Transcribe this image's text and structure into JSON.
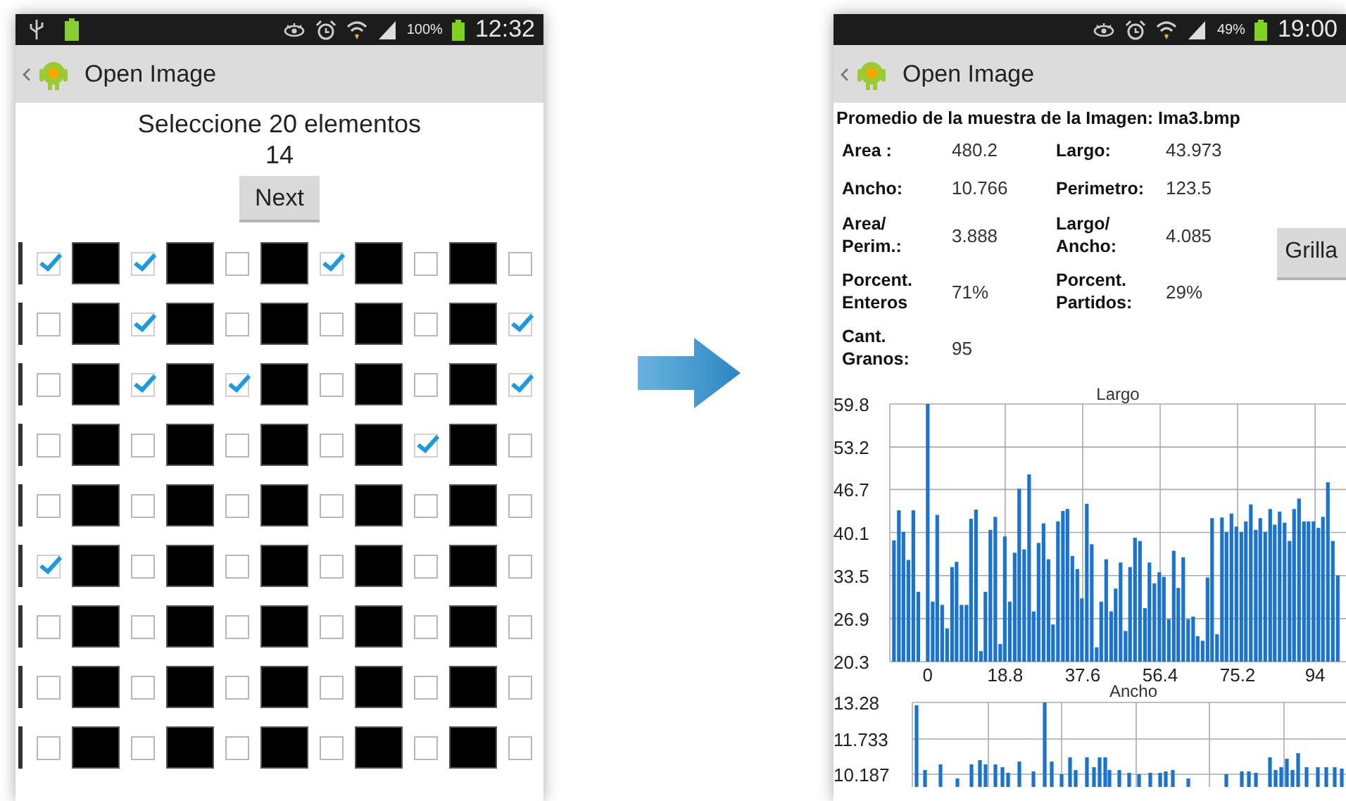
{
  "left_phone": {
    "status_bar": {
      "battery": "100%",
      "time": "12:32"
    },
    "action_bar": {
      "title": "Open Image"
    },
    "prompt": "Seleccione 20 elementos",
    "count": "14",
    "next_button": "Next",
    "grid": {
      "rows": [
        {
          "checks": [
            true,
            true,
            false,
            true,
            false,
            false
          ]
        },
        {
          "checks": [
            false,
            true,
            false,
            false,
            false,
            true
          ]
        },
        {
          "checks": [
            false,
            true,
            true,
            false,
            false,
            true
          ]
        },
        {
          "checks": [
            false,
            false,
            false,
            false,
            true,
            false
          ]
        },
        {
          "checks": [
            false,
            false,
            false,
            false,
            false,
            false
          ]
        },
        {
          "checks": [
            true,
            false,
            false,
            false,
            false,
            false
          ]
        },
        {
          "checks": [
            false,
            false,
            false,
            false,
            false,
            false
          ]
        },
        {
          "checks": [
            false,
            false,
            false,
            false,
            false,
            false
          ]
        },
        {
          "checks": [
            false,
            false,
            false,
            false,
            false,
            false
          ]
        }
      ]
    }
  },
  "right_phone": {
    "status_bar": {
      "battery": "49%",
      "time": "19:00"
    },
    "action_bar": {
      "title": "Open Image"
    },
    "heading": "Promedio de la muestra de la Imagen: Ima3.bmp",
    "stats": [
      [
        {
          "label": "Area :",
          "value": "480.2"
        },
        {
          "label": "Largo:",
          "value": "43.973"
        }
      ],
      [
        {
          "label": "Ancho:",
          "value": "10.766"
        },
        {
          "label": "Perimetro:",
          "value": "123.5"
        }
      ],
      [
        {
          "label": "Area/\nPerim.:",
          "value": "3.888"
        },
        {
          "label": "Largo/\nAncho:",
          "value": "4.085"
        }
      ],
      [
        {
          "label": "Porcent.\nEnteros",
          "value": "71%"
        },
        {
          "label": "Porcent.\nPartidos:",
          "value": "29%"
        }
      ],
      [
        {
          "label": "Cant.\nGranos:",
          "value": "95"
        }
      ]
    ],
    "grilla_button": "Grilla",
    "largo_chart": {
      "chart_data": {
        "type": "bar",
        "title": "Largo",
        "x": [
          -8.2,
          -7.0,
          -5.9,
          -4.7,
          -3.5,
          -2.3,
          0,
          1.2,
          2.3,
          3.5,
          4.7,
          5.9,
          7.0,
          8.2,
          9.4,
          10.5,
          11.7,
          12.9,
          14.0,
          15.2,
          16.4,
          17.6,
          18.7,
          19.9,
          21.1,
          22.2,
          23.4,
          24.6,
          25.7,
          26.9,
          28.1,
          29.3,
          30.4,
          31.6,
          32.8,
          33.9,
          35.1,
          36.3,
          37.4,
          38.6,
          39.8,
          41.0,
          42.1,
          43.3,
          44.5,
          45.6,
          46.8,
          48.0,
          49.1,
          50.3,
          51.5,
          52.7,
          53.8,
          55.0,
          56.2,
          57.3,
          58.5,
          59.7,
          60.8,
          62.0,
          63.2,
          64.4,
          65.5,
          66.7,
          67.9,
          69.0,
          70.2,
          71.4,
          72.5,
          73.7,
          74.9,
          76.1,
          77.2,
          78.4,
          79.6,
          80.7,
          81.9,
          83.1,
          84.2,
          85.4,
          86.6,
          87.8,
          88.9,
          90.1,
          91.3,
          92.4,
          93.6,
          94.8,
          95.9,
          97.1,
          98.3,
          99.5
        ],
        "values": [
          38.9,
          43.5,
          40.2,
          35.9,
          43.5,
          31.0,
          59.8,
          29.5,
          42.8,
          29,
          25.4,
          34.8,
          35.6,
          29,
          29,
          42.2,
          43.6,
          21.9,
          31,
          40.5,
          42.5,
          23,
          39.5,
          29.5,
          37,
          46.8,
          37.5,
          49,
          28,
          38.5,
          41.5,
          36,
          26,
          41.8,
          43.4,
          43.7,
          36.5,
          34.5,
          30,
          44.5,
          38.3,
          22.5,
          29.5,
          36,
          28,
          31.5,
          35.5,
          25,
          34.8,
          39.3,
          38.8,
          28.5,
          35.5,
          32.3,
          34,
          33.3,
          26.8,
          37.3,
          31.6,
          36.3,
          26.8,
          27.2,
          24.2,
          23.5,
          33.2,
          42.3,
          24.5,
          42.4,
          40.2,
          43,
          41,
          40.2,
          41.8,
          44.4,
          40.5,
          42.3,
          40.2,
          43.7,
          41.3,
          43.3,
          41.6,
          38.8,
          43.7,
          45.3,
          41.8,
          41.8,
          41.8,
          40.8,
          42.5,
          47.8,
          38.8,
          33.5
        ],
        "grid": true,
        "xlim": [
          -9.2,
          101.5
        ],
        "ylim": [
          20.3,
          59.8
        ],
        "xticks": [
          0,
          18.8,
          37.6,
          56.4,
          75.2,
          94
        ],
        "yticks": [
          20.3,
          26.9,
          33.5,
          40.1,
          46.7,
          53.2,
          59.8
        ]
      }
    },
    "ancho_chart": {
      "title": "Ancho",
      "y_labels": [
        "13.28",
        "11.733",
        "10.187"
      ]
    }
  }
}
